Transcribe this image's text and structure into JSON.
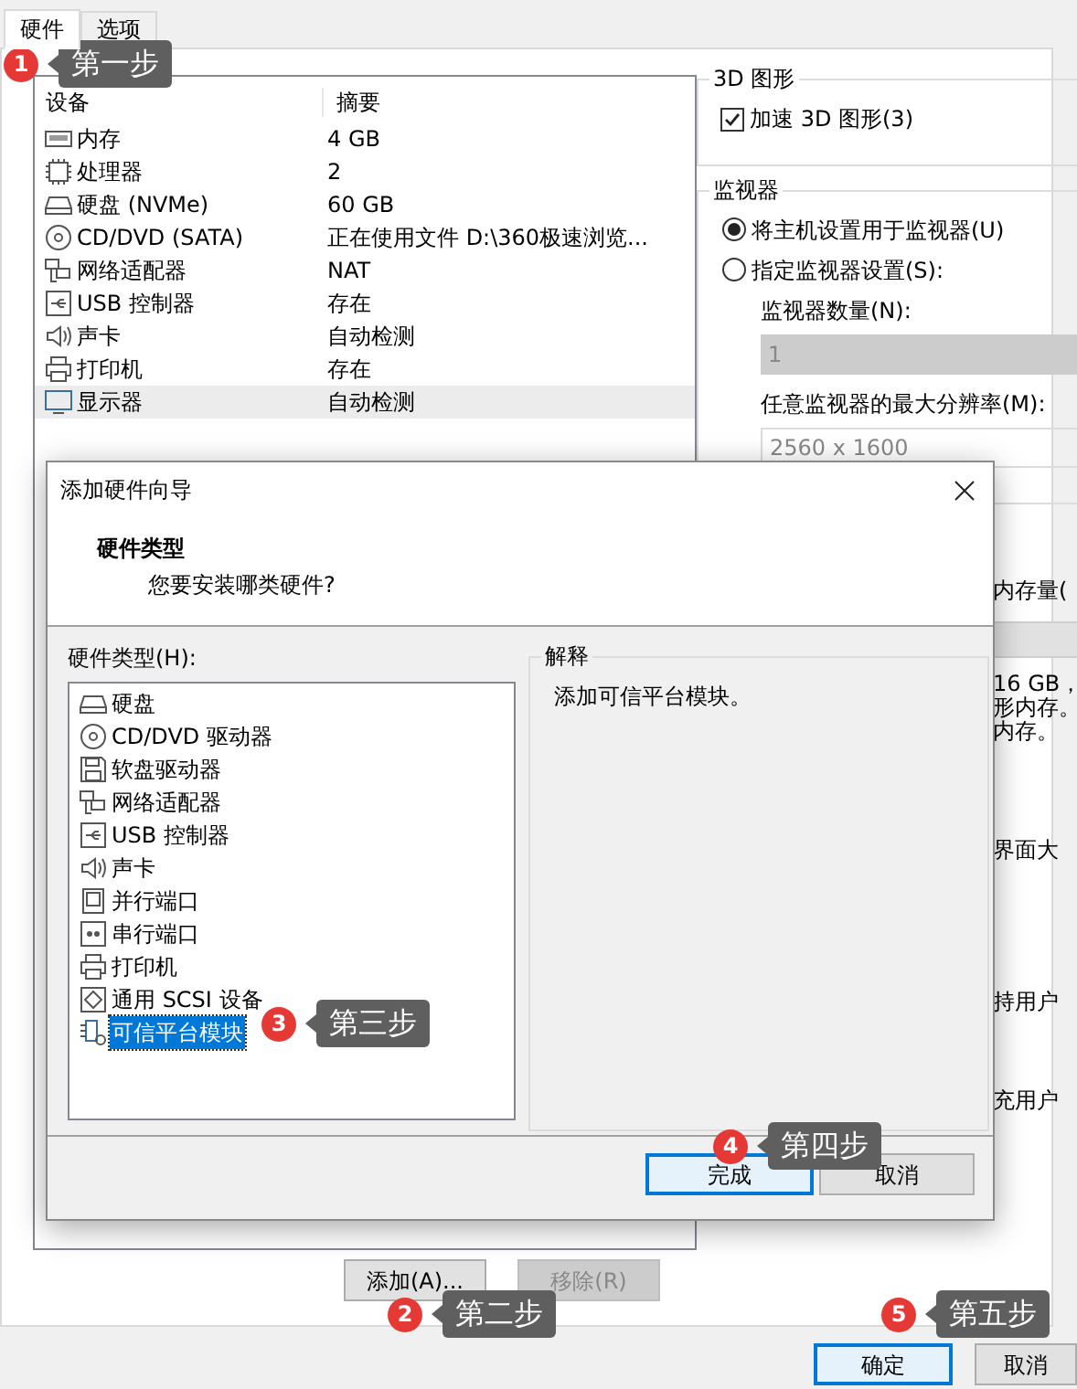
{
  "tabs": [
    {
      "label": "硬件",
      "selected": true
    },
    {
      "label": "选项",
      "selected": false
    }
  ],
  "device_table": {
    "columns": [
      "设备",
      "摘要"
    ],
    "rows": [
      {
        "kind": "memory",
        "device": "内存",
        "summary": "4 GB",
        "selected": false
      },
      {
        "kind": "cpu",
        "device": "处理器",
        "summary": "2",
        "selected": false
      },
      {
        "kind": "disk",
        "device": "硬盘 (NVMe)",
        "summary": "60 GB",
        "selected": false
      },
      {
        "kind": "cdrom",
        "device": "CD/DVD (SATA)",
        "summary": "正在使用文件 D:\\360极速浏览...",
        "selected": false
      },
      {
        "kind": "network",
        "device": "网络适配器",
        "summary": "NAT",
        "selected": false
      },
      {
        "kind": "usb",
        "device": "USB 控制器",
        "summary": "存在",
        "selected": false
      },
      {
        "kind": "sound",
        "device": "声卡",
        "summary": "自动检测",
        "selected": false
      },
      {
        "kind": "printer",
        "device": "打印机",
        "summary": "存在",
        "selected": false
      },
      {
        "kind": "display",
        "device": "显示器",
        "summary": "自动检测",
        "selected": true
      }
    ]
  },
  "device_buttons": [
    {
      "label": "添加(A)...",
      "disabled": false
    },
    {
      "label": "移除(R)",
      "disabled": true
    }
  ],
  "graphics_group": {
    "title": "3D 图形",
    "checkbox": {
      "label": "加速 3D 图形(3)",
      "checked": true
    }
  },
  "monitor_group": {
    "title": "监视器",
    "options": [
      {
        "label": "将主机设置用于监视器(U)",
        "selected": true
      },
      {
        "label": "指定监视器设置(S):",
        "selected": false
      }
    ],
    "count_label": "监视器数量(N):",
    "count_value": "1",
    "resolution_label": "任意监视器的最大分辨率(M):",
    "resolution_value": "2560 x 1600"
  },
  "partial_texts": {
    "memory_label": "内存量(",
    "memory_lines": [
      "16 GB，",
      "形内存。",
      "内存。"
    ],
    "scale_label": "界面大",
    "keep_label": "持用户",
    "fill_label": "充用户"
  },
  "dialog": {
    "title": "添加硬件向导",
    "heading": "硬件类型",
    "subheading": "您要安装哪类硬件?",
    "list_label": "硬件类型(H):",
    "items": [
      {
        "kind": "disk",
        "label": "硬盘",
        "selected": false
      },
      {
        "kind": "cdrom",
        "label": "CD/DVD 驱动器",
        "selected": false
      },
      {
        "kind": "floppy",
        "label": "软盘驱动器",
        "selected": false
      },
      {
        "kind": "network",
        "label": "网络适配器",
        "selected": false
      },
      {
        "kind": "usb",
        "label": "USB 控制器",
        "selected": false
      },
      {
        "kind": "sound",
        "label": "声卡",
        "selected": false
      },
      {
        "kind": "parallel",
        "label": "并行端口",
        "selected": false
      },
      {
        "kind": "serial",
        "label": "串行端口",
        "selected": false
      },
      {
        "kind": "printer",
        "label": "打印机",
        "selected": false
      },
      {
        "kind": "scsi",
        "label": "通用 SCSI 设备",
        "selected": false
      },
      {
        "kind": "tpm",
        "label": "可信平台模块",
        "selected": true
      }
    ],
    "explanation_title": "解释",
    "explanation": "添加可信平台模块。",
    "buttons": [
      {
        "label": "完成",
        "default": true
      },
      {
        "label": "取消",
        "default": false
      }
    ]
  },
  "footer_buttons": [
    {
      "label": "确定",
      "default": true
    },
    {
      "label": "取消",
      "default": false
    }
  ],
  "annotations": [
    {
      "number": "1",
      "text": "第一步"
    },
    {
      "number": "2",
      "text": "第二步"
    },
    {
      "number": "3",
      "text": "第三步"
    },
    {
      "number": "4",
      "text": "第四步"
    },
    {
      "number": "5",
      "text": "第五步"
    }
  ]
}
